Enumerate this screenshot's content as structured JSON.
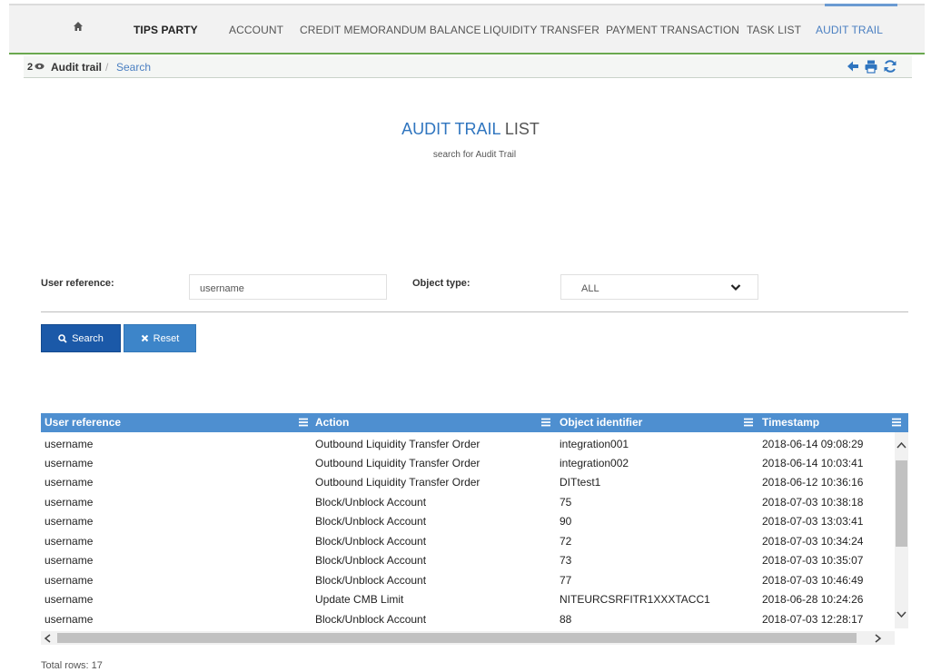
{
  "nav": {
    "items": [
      {
        "label": "TIPS PARTY"
      },
      {
        "label": "ACCOUNT"
      },
      {
        "label": "CREDIT MEMORANDUM BALANCE"
      },
      {
        "label": "LIQUIDITY TRANSFER"
      },
      {
        "label": "PAYMENT TRANSACTION"
      },
      {
        "label": "TASK LIST"
      },
      {
        "label": "AUDIT TRAIL"
      }
    ],
    "active": "AUDIT TRAIL",
    "home_icon": "home-icon"
  },
  "breadcrumb": {
    "count": "2",
    "eye_icon": "eye-icon",
    "current": "Audit trail",
    "separator": "/",
    "sub": "Search"
  },
  "toolbar": {
    "icons": [
      "back-arrow-icon",
      "print-icon",
      "refresh-icon"
    ]
  },
  "page": {
    "title_part1": "AUDIT TRAIL",
    "title_part2": " LIST",
    "subtitle": "search for Audit Trail"
  },
  "filters": {
    "user_reference_label": "User reference:",
    "user_reference_value": "username",
    "object_type_label": "Object type:",
    "object_type_value": "ALL"
  },
  "buttons": {
    "search": "Search",
    "reset": "Reset"
  },
  "table": {
    "columns": [
      "User reference",
      "Action",
      "Object identifier",
      "Timestamp"
    ],
    "rows": [
      [
        "username",
        "Outbound Liquidity Transfer Order",
        "integration001",
        "2018-06-14 09:08:29"
      ],
      [
        "username",
        "Outbound Liquidity Transfer Order",
        "integration002",
        "2018-06-14 10:03:41"
      ],
      [
        "username",
        "Outbound Liquidity Transfer Order",
        "DITtest1",
        "2018-06-12 10:36:16"
      ],
      [
        "username",
        "Block/Unblock Account",
        "75",
        "2018-07-03 10:38:18"
      ],
      [
        "username",
        "Block/Unblock Account",
        "90",
        "2018-07-03 13:03:41"
      ],
      [
        "username",
        "Block/Unblock Account",
        "72",
        "2018-07-03 10:34:24"
      ],
      [
        "username",
        "Block/Unblock Account",
        "73",
        "2018-07-03 10:35:07"
      ],
      [
        "username",
        "Block/Unblock Account",
        "77",
        "2018-07-03 10:46:49"
      ],
      [
        "username",
        "Update CMB Limit",
        "NITEURCSRFITR1XXXTACC1",
        "2018-06-28 10:24:26"
      ],
      [
        "username",
        "Block/Unblock Account",
        "88",
        "2018-07-03 12:28:17"
      ]
    ]
  },
  "footer": {
    "total_rows": "Total rows: 17"
  },
  "colors": {
    "accent": "#2f75bf",
    "header": "#4e8fd0",
    "search_button": "#1b59a8",
    "reset_button": "#3d85c9",
    "nav_border": "#6aa84f"
  }
}
